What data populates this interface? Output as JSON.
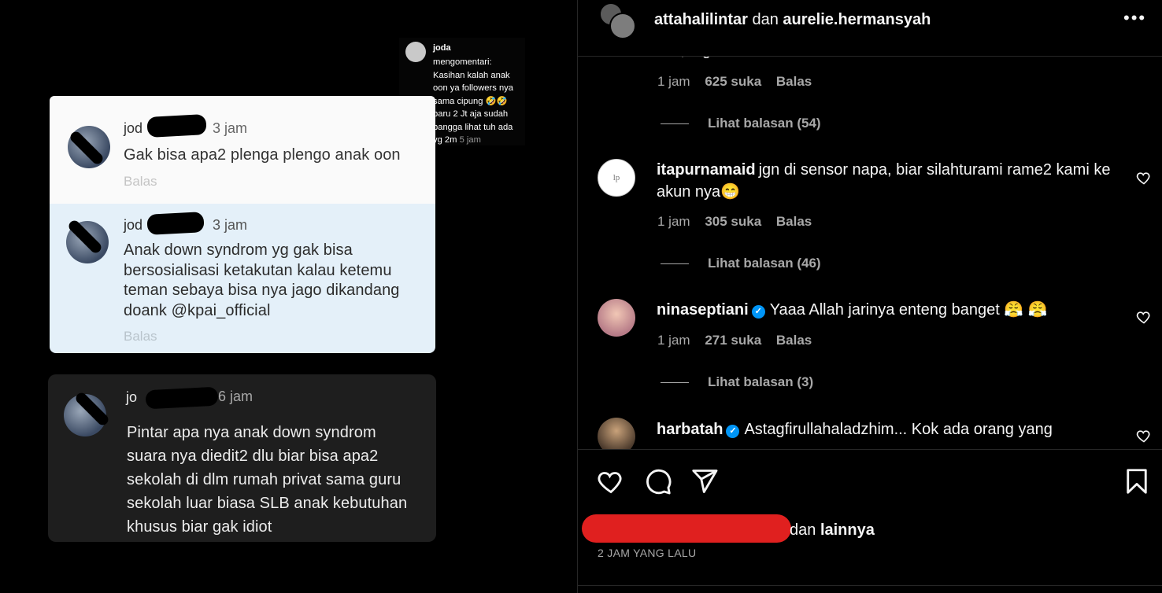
{
  "post": {
    "tile1": {
      "username": "jod",
      "time": "3 jam",
      "text": "Gak bisa apa2 plenga plengo anak oon",
      "reply": "Balas"
    },
    "tile2": {
      "username": "jod",
      "time": "3 jam",
      "text": "Anak down syndrom yg gak bisa\nbersosialisasi ketakutan kalau ketemu\nteman sebaya bisa nya jago dikandang\ndoank @kpai_official",
      "reply": "Balas"
    },
    "tile3": {
      "username": "jo",
      "time": "6 jam",
      "text": "Pintar apa nya anak down syndrom\nsuara nya diedit2 dlu biar bisa apa2\nsekolah di dlm rumah privat sama guru\nsekolah luar biasa SLB anak kebutuhan\nkhusus biar gak idiot"
    },
    "notification": {
      "username": "joda",
      "text": "mengomentari:\nKasihan kalah anak\noon ya followers nya\nsama cipung 🤣🤣\nbaru 2 Jt aja sudah\nbangga lihat tuh ada\nyg 2m",
      "time": "5 jam"
    }
  },
  "header": {
    "user1": "attahalilintar",
    "connector": "dan",
    "user2": "aurelie.hermansyah",
    "more_icon": "more-horizontal-icon"
  },
  "comments": {
    "partial_text": "hati, rugi ..",
    "partial_meta": {
      "time": "1 jam",
      "likes": "625 suka",
      "reply": "Balas"
    },
    "partial_replies": "Lihat balasan (54)",
    "items": [
      {
        "username": "itapurnamaid",
        "text": "jgn di sensor napa, biar silahturami rame2 kami ke akun nya😁",
        "time": "1 jam",
        "likes": "305 suka",
        "reply": "Balas",
        "view_replies": "Lihat balasan (46)",
        "verified": false
      },
      {
        "username": "ninaseptiani",
        "text": "Yaaa Allah jarinya enteng banget 😤 😤",
        "time": "1 jam",
        "likes": "271 suka",
        "reply": "Balas",
        "view_replies": "Lihat balasan (3)",
        "verified": true
      },
      {
        "username": "harbatah",
        "text": "Astagfirullahaladzhim... Kok ada orang yang",
        "verified": true
      }
    ]
  },
  "actions": {
    "like_icon": "heart-icon",
    "comment_icon": "comment-bubble-icon",
    "share_icon": "send-icon",
    "save_icon": "bookmark-icon",
    "liked_by_connector": "dan",
    "liked_by_others": "lainnya",
    "timestamp": "2 JAM YANG LALU"
  },
  "colors": {
    "background": "#000000",
    "text": "#f5f5f5",
    "muted": "#a8a8a8",
    "divider": "#262626",
    "verified": "#0095f6",
    "redaction": "#e0201f"
  }
}
